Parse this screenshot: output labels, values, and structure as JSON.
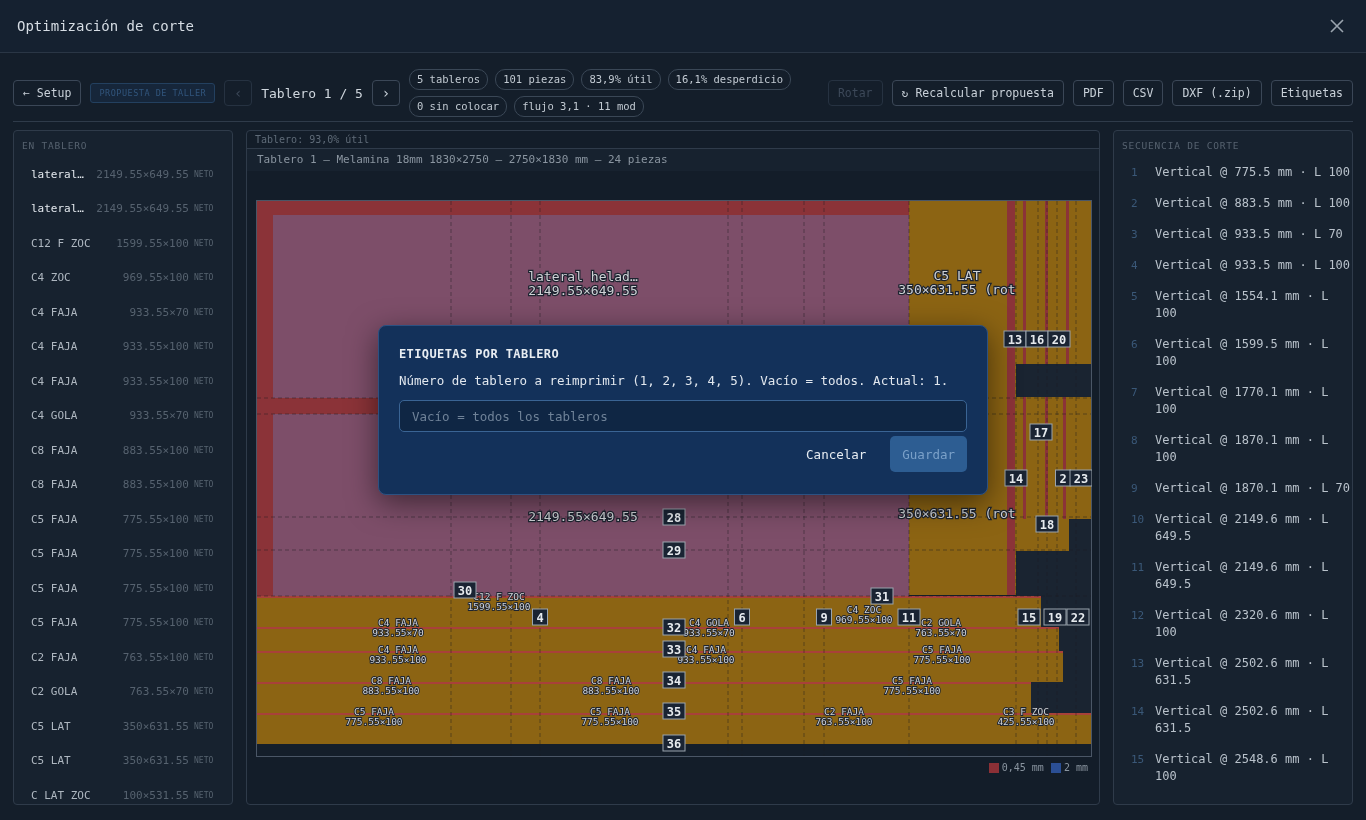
{
  "window": {
    "title": "Optimización de corte"
  },
  "toolbar": {
    "back": {
      "label": "← Setup",
      "disabled": false
    },
    "proposal_tag": "PROPUESTA DE TALLER",
    "prev": {
      "label": "‹",
      "disabled": true
    },
    "board_indicator": "Tablero 1 / 5",
    "next": {
      "label": "›",
      "disabled": false
    },
    "stats": [
      "5 tableros",
      "101 piezas",
      "83,9% útil",
      "16,1% desperdicio",
      "0 sin colocar",
      "flujo 3,1 · 11 mod"
    ],
    "actions": [
      {
        "label": "Rotar",
        "disabled": true
      },
      {
        "label": "↻ Recalcular propuesta",
        "disabled": false
      },
      {
        "label": "PDF",
        "disabled": false
      },
      {
        "label": "CSV",
        "disabled": false
      },
      {
        "label": "DXF (.zip)",
        "disabled": false
      },
      {
        "label": "Etiquetas",
        "disabled": false
      }
    ]
  },
  "pieces_panel": {
    "title": "EN TABLERO",
    "items": [
      {
        "name": "lateral…",
        "size": "2149.55×649.55",
        "tag": "NETO",
        "highlighted": true
      },
      {
        "name": "lateral…",
        "size": "2149.55×649.55",
        "tag": "NETO",
        "highlighted": true
      },
      {
        "name": "C12 F ZOC",
        "size": "1599.55×100",
        "tag": "NETO",
        "highlighted": false
      },
      {
        "name": "C4 ZOC",
        "size": "969.55×100",
        "tag": "NETO",
        "highlighted": false
      },
      {
        "name": "C4 FAJA",
        "size": "933.55×70",
        "tag": "NETO",
        "highlighted": false
      },
      {
        "name": "C4 FAJA",
        "size": "933.55×100",
        "tag": "NETO",
        "highlighted": false
      },
      {
        "name": "C4 FAJA",
        "size": "933.55×100",
        "tag": "NETO",
        "highlighted": false
      },
      {
        "name": "C4 GOLA",
        "size": "933.55×70",
        "tag": "NETO",
        "highlighted": false
      },
      {
        "name": "C8 FAJA",
        "size": "883.55×100",
        "tag": "NETO",
        "highlighted": false
      },
      {
        "name": "C8 FAJA",
        "size": "883.55×100",
        "tag": "NETO",
        "highlighted": false
      },
      {
        "name": "C5 FAJA",
        "size": "775.55×100",
        "tag": "NETO",
        "highlighted": false
      },
      {
        "name": "C5 FAJA",
        "size": "775.55×100",
        "tag": "NETO",
        "highlighted": false
      },
      {
        "name": "C5 FAJA",
        "size": "775.55×100",
        "tag": "NETO",
        "highlighted": false
      },
      {
        "name": "C5 FAJA",
        "size": "775.55×100",
        "tag": "NETO",
        "highlighted": false
      },
      {
        "name": "C2 FAJA",
        "size": "763.55×100",
        "tag": "NETO",
        "highlighted": false
      },
      {
        "name": "C2 GOLA",
        "size": "763.55×70",
        "tag": "NETO",
        "highlighted": false
      },
      {
        "name": "C5 LAT",
        "size": "350×631.55",
        "tag": "NETO",
        "highlighted": false
      },
      {
        "name": "C5 LAT",
        "size": "350×631.55",
        "tag": "NETO",
        "highlighted": false
      },
      {
        "name": "C LAT ZOC",
        "size": "100×531.55",
        "tag": "NETO",
        "highlighted": false
      }
    ]
  },
  "board": {
    "utilization": "Tablero: 93,0% útil",
    "caption": "Tablero 1 — Melamina 18mm 1830×2750 — 2750×1830 mm — 24 piezas",
    "labels": [
      {
        "name": "lateral helad…",
        "size": "2149.55×649.55"
      },
      {
        "size": "2149.55×649.55"
      },
      {
        "name": "C5 LAT",
        "size": "350×631.55 (rot"
      },
      {
        "size": "350×631.55 (rot"
      },
      {
        "name": "C12 F ZOC",
        "size": "1599.55×100"
      },
      {
        "name": "C4 ZOC",
        "size": "969.55×100"
      },
      {
        "name": "C4 FAJA",
        "size": "933.55×70"
      },
      {
        "name": "C4 GOLA",
        "size": "933.55×70"
      },
      {
        "name": "C2 GOLA",
        "size": "763.55×70"
      },
      {
        "name": "C4 FAJA",
        "size": "933.55×100"
      },
      {
        "name": "C4 FAJA",
        "size": "933.55×100"
      },
      {
        "name": "C5 FAJA",
        "size": "775.55×100"
      },
      {
        "name": "C8 FAJA",
        "size": "883.55×100"
      },
      {
        "name": "C8 FAJA",
        "size": "883.55×100"
      },
      {
        "name": "C5 FAJA",
        "size": "775.55×100"
      },
      {
        "name": "C5 FAJA",
        "size": "775.55×100"
      },
      {
        "name": "C5 FAJA",
        "size": "775.55×100"
      },
      {
        "name": "C2 FAJA",
        "size": "763.55×100"
      },
      {
        "name": "C3 F ZOC",
        "size": "425.55×100"
      }
    ],
    "numbers": [
      "13",
      "16",
      "20",
      "17",
      "14",
      "2",
      "23",
      "18",
      "28",
      "29",
      "30",
      "31",
      "4",
      "6",
      "9",
      "11",
      "15",
      "19",
      "22",
      "32",
      "33",
      "34",
      "35",
      "36"
    ],
    "legend": [
      {
        "label": "0,45 mm",
        "color": "#8b3036"
      },
      {
        "label": "2 mm",
        "color": "#2b4f94"
      }
    ]
  },
  "sequence": {
    "title": "SECUENCIA DE CORTE",
    "steps": [
      {
        "number": "1",
        "text": "Vertical @ 775.5 mm · L 100"
      },
      {
        "number": "2",
        "text": "Vertical @ 883.5 mm · L 100"
      },
      {
        "number": "3",
        "text": "Vertical @ 933.5 mm · L 70"
      },
      {
        "number": "4",
        "text": "Vertical @ 933.5 mm · L 100"
      },
      {
        "number": "5",
        "text": "Vertical @ 1554.1 mm · L 100"
      },
      {
        "number": "6",
        "text": "Vertical @ 1599.5 mm · L 100"
      },
      {
        "number": "7",
        "text": "Vertical @ 1770.1 mm · L 100"
      },
      {
        "number": "8",
        "text": "Vertical @ 1870.1 mm · L 100"
      },
      {
        "number": "9",
        "text": "Vertical @ 1870.1 mm · L 70"
      },
      {
        "number": "10",
        "text": "Vertical @ 2149.6 mm · L 649.5"
      },
      {
        "number": "11",
        "text": "Vertical @ 2149.6 mm · L 649.5"
      },
      {
        "number": "12",
        "text": "Vertical @ 2320.6 mm · L 100"
      },
      {
        "number": "13",
        "text": "Vertical @ 2502.6 mm · L 631.5"
      },
      {
        "number": "14",
        "text": "Vertical @ 2502.6 mm · L 631.5"
      },
      {
        "number": "15",
        "text": "Vertical @ 2548.6 mm · L 100"
      }
    ]
  },
  "dialog": {
    "title": "ETIQUETAS POR TABLERO",
    "message": "Número de tablero a reimprimir (1, 2, 3, 4, 5). Vacío = todos. Actual: 1.",
    "input": {
      "placeholder": "Vacío = todos los tableros"
    },
    "buttons": [
      {
        "label": "Cancelar",
        "kind": "text",
        "disabled": false
      },
      {
        "label": "Guardar",
        "kind": "primary",
        "disabled": true
      }
    ]
  }
}
